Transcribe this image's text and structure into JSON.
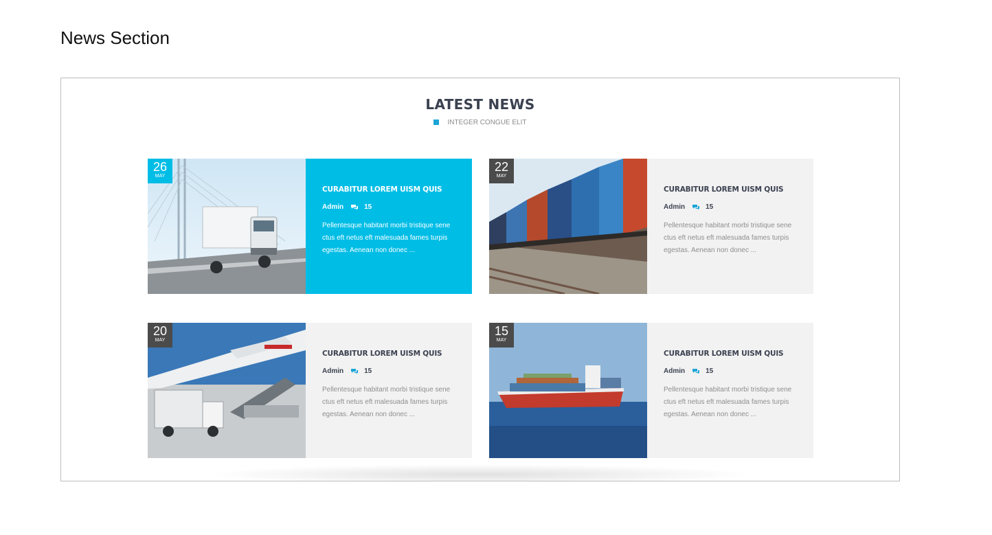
{
  "doc": {
    "heading": "News Section"
  },
  "section": {
    "title": "LATEST NEWS",
    "subtitle": "INTEGER CONGUE ELIT",
    "accent_color": "#00bde6"
  },
  "cards": [
    {
      "day": "26",
      "month": "MAY",
      "title": "CURABITUR LOREM UISM QUIS",
      "author": "Admin",
      "comments": "15",
      "excerpt": "Pellentesque habitant morbi tristique sene ctus eft netus eft malesuada fames turpis egestas. Aenean non donec ...",
      "image": "truck-on-bridge"
    },
    {
      "day": "22",
      "month": "MAY",
      "title": "CURABITUR LOREM UISM QUIS",
      "author": "Admin",
      "comments": "15",
      "excerpt": "Pellentesque habitant morbi tristique sene ctus eft netus eft malesuada fames turpis egestas. Aenean non donec ...",
      "image": "freight-train-containers"
    },
    {
      "day": "20",
      "month": "MAY",
      "title": "CURABITUR LOREM UISM QUIS",
      "author": "Admin",
      "comments": "15",
      "excerpt": "Pellentesque habitant morbi tristique sene ctus eft netus eft malesuada fames turpis egestas. Aenean non donec ...",
      "image": "airplane-loading"
    },
    {
      "day": "15",
      "month": "MAY",
      "title": "CURABITUR LOREM UISM QUIS",
      "author": "Admin",
      "comments": "15",
      "excerpt": "Pellentesque habitant morbi tristique sene ctus eft netus eft malesuada fames turpis egestas. Aenean non donec ...",
      "image": "container-ship"
    }
  ]
}
